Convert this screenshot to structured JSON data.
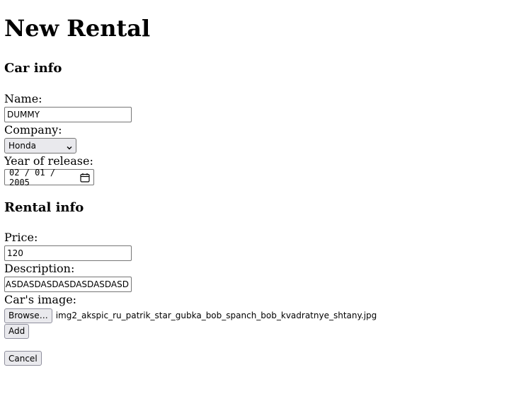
{
  "page": {
    "title": "New Rental"
  },
  "car_info": {
    "heading": "Car info",
    "name_label": "Name:",
    "name_value": "DUMMY",
    "company_label": "Company:",
    "company_value": "Honda",
    "year_label": "Year of release:",
    "year_month": "02",
    "year_day": "01",
    "year_year": "2005",
    "date_separator": "/"
  },
  "rental_info": {
    "heading": "Rental info",
    "price_label": "Price:",
    "price_value": "120",
    "description_label": "Description:",
    "description_value": "ASDASDASDASDASDASDASD",
    "image_label": "Car's image:",
    "browse_label": "Browse…",
    "file_name": "img2_akspic_ru_patrik_star_gubka_bob_spanch_bob_kvadratnye_shtany.jpg"
  },
  "actions": {
    "add_label": "Add",
    "cancel_label": "Cancel"
  },
  "icons": {
    "company_dropdown": "chevron-down-icon",
    "date_picker": "calendar-icon"
  }
}
